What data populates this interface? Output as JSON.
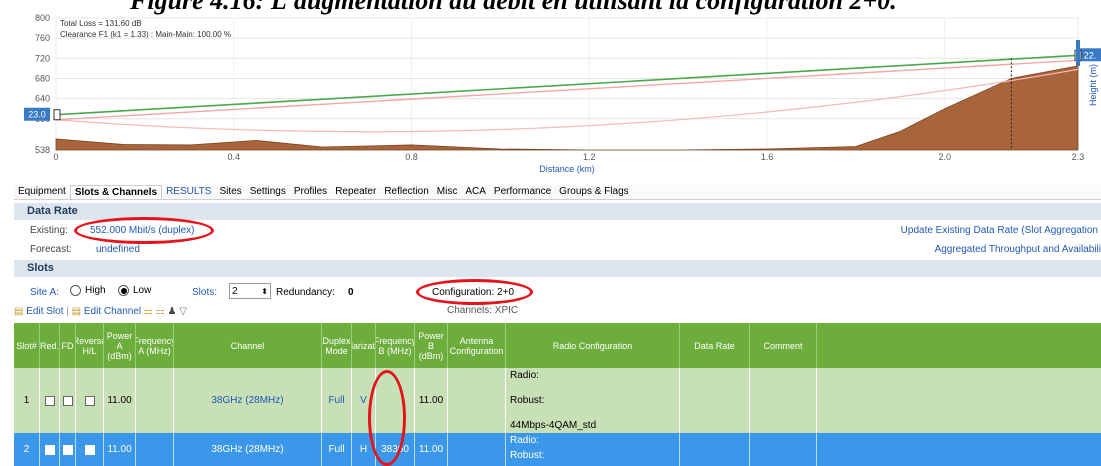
{
  "caption": "Figure 4.16: L'augmentation du débit en utilisant la configuration 2+0.",
  "profile": {
    "annotations": [
      "Total Loss = 131.60 dB",
      "Clearance F1 (k1 = 1.33) :   Main-Main:  100.00 %"
    ],
    "left_height_tag": "23.0",
    "right_height_tag": "22.",
    "x_axis_label": "Distance (km)",
    "y_axis_label": "Height (m)",
    "chart_data": {
      "type": "area",
      "x": [
        0,
        0.4,
        0.8,
        1.2,
        1.6,
        2.0,
        2.3
      ],
      "x_ticks": [
        "0",
        "0.4",
        "0.8",
        "1.2",
        "1.6",
        "2.0",
        "2.3"
      ],
      "y_ticks": [
        "800",
        "760",
        "720",
        "680",
        "640",
        "600",
        "538"
      ],
      "xlim": [
        0,
        2.3
      ],
      "ylim": [
        538,
        800
      ],
      "xlabel": "Distance (km)",
      "ylabel": "Height (m)",
      "series": [
        {
          "values": [
            560,
            549,
            548,
            557,
            544,
            548,
            540,
            538,
            538,
            540,
            545,
            575,
            620,
            680,
            705
          ],
          "x": [
            0,
            0.15,
            0.3,
            0.45,
            0.6,
            0.8,
            1.0,
            1.2,
            1.4,
            1.6,
            1.8,
            1.9,
            2.0,
            2.15,
            2.3
          ],
          "color": "#a8643a"
        },
        {
          "values": [
            608,
            726
          ],
          "x": [
            0,
            2.3
          ],
          "color": "#4aa84a"
        },
        {
          "values": [
            598,
            716
          ],
          "x": [
            0,
            2.3
          ],
          "color": "#f3a6a6"
        },
        {
          "values": [
            598,
            560,
            598
          ],
          "x": [
            0,
            1.15,
            2.3
          ],
          "color": "#f3b8b8"
        }
      ]
    }
  },
  "tabs": [
    "Equipment",
    "Slots & Channels",
    "RESULTS",
    "Sites",
    "Settings",
    "Profiles",
    "Repeater",
    "Reflection",
    "Misc",
    "ACA",
    "Performance",
    "Groups & Flags"
  ],
  "data_rate": {
    "title": "Data Rate",
    "existing_label": "Existing:",
    "existing_value": "552.000 Mbit/s (duplex)",
    "forecast_label": "Forecast:",
    "forecast_value": "undefined",
    "link1": "Update Existing Data Rate (Slot Aggregation",
    "link2": "Aggregated Throughput and Availabili"
  },
  "slots": {
    "title": "Slots",
    "site_label": "Site A:",
    "radio_high": "High",
    "radio_low": "Low",
    "slots_label": "Slots:",
    "slots_value": "2",
    "redundancy_label": "Redundancy:",
    "redundancy_value": "0",
    "configuration": "Configuration: 2+0",
    "channels": "Channels: XPIC",
    "edit_slot": "Edit Slot",
    "edit_channel": "Edit Channel"
  },
  "grid": {
    "headers": [
      "Slot#",
      "Red.",
      "FD",
      "Reverse H/L",
      "Power A (dBm)",
      "Frequency A (MHz)",
      "Channel",
      "Duplex Mode",
      "Polarization",
      "Frequency B (MHz)",
      "Power B (dBm)",
      "Antenna Configuration",
      "Radio Configuration",
      "Data Rate",
      "Comment"
    ],
    "rows": [
      {
        "slot": "1",
        "power_a": "11.00",
        "freq_a": "",
        "channel": "38GHz (28MHz)",
        "duplex": "Full",
        "pol": "V",
        "freq_b": "",
        "power_b": "11.00",
        "radio1": "Radio:",
        "radio2": "Robust:",
        "radio3": "44Mbps-4QAM_std"
      },
      {
        "slot": "2",
        "power_a": "11.00",
        "freq_a": "",
        "channel": "38GHz (28MHz)",
        "duplex": "Full",
        "pol": "H",
        "freq_b": "38360",
        "power_b": "11.00",
        "radio1": "Radio:",
        "radio2": "Robust:",
        "radio3": ""
      }
    ]
  }
}
